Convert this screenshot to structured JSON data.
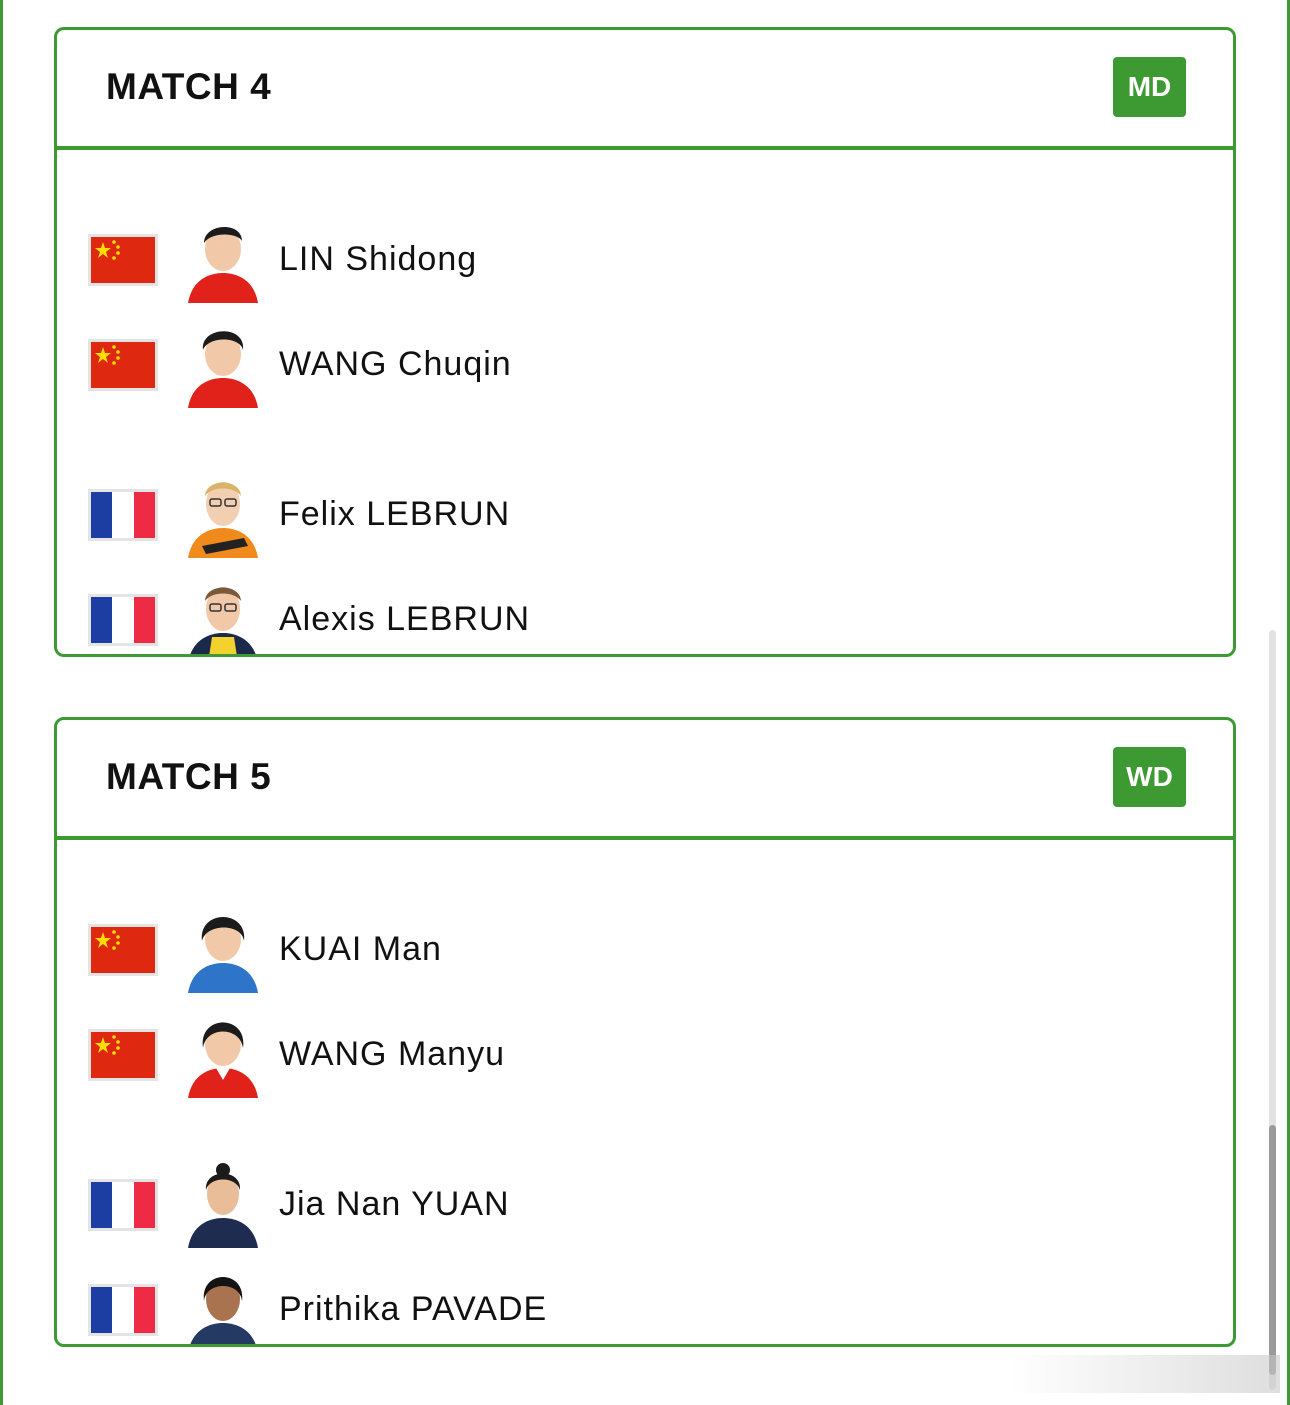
{
  "colors": {
    "accent": "#3d9a32",
    "china_red": "#de2910",
    "china_star": "#ffde00",
    "france_blue": "#1c3ea3",
    "france_red": "#ee2a44"
  },
  "matches": [
    {
      "title": "MATCH 4",
      "badge": "MD",
      "teams": [
        {
          "players": [
            {
              "name": "LIN Shidong",
              "flag": "china-flag",
              "jersey": "#e0221a"
            },
            {
              "name": "WANG Chuqin",
              "flag": "china-flag",
              "jersey": "#e0221a"
            }
          ]
        },
        {
          "players": [
            {
              "name": "Felix LEBRUN",
              "flag": "france-flag",
              "jersey": "#f08a1d"
            },
            {
              "name": "Alexis LEBRUN",
              "flag": "france-flag",
              "jersey": "#1b2a4a"
            }
          ]
        }
      ]
    },
    {
      "title": "MATCH 5",
      "badge": "WD",
      "teams": [
        {
          "players": [
            {
              "name": "KUAI Man",
              "flag": "china-flag",
              "jersey": "#2e74c9"
            },
            {
              "name": "WANG Manyu",
              "flag": "china-flag",
              "jersey": "#e0221a"
            }
          ]
        },
        {
          "players": [
            {
              "name": "Jia Nan YUAN",
              "flag": "france-flag",
              "jersey": "#1e2d4f"
            },
            {
              "name": "Prithika PAVADE",
              "flag": "france-flag",
              "jersey": "#243a63"
            }
          ]
        }
      ]
    }
  ]
}
